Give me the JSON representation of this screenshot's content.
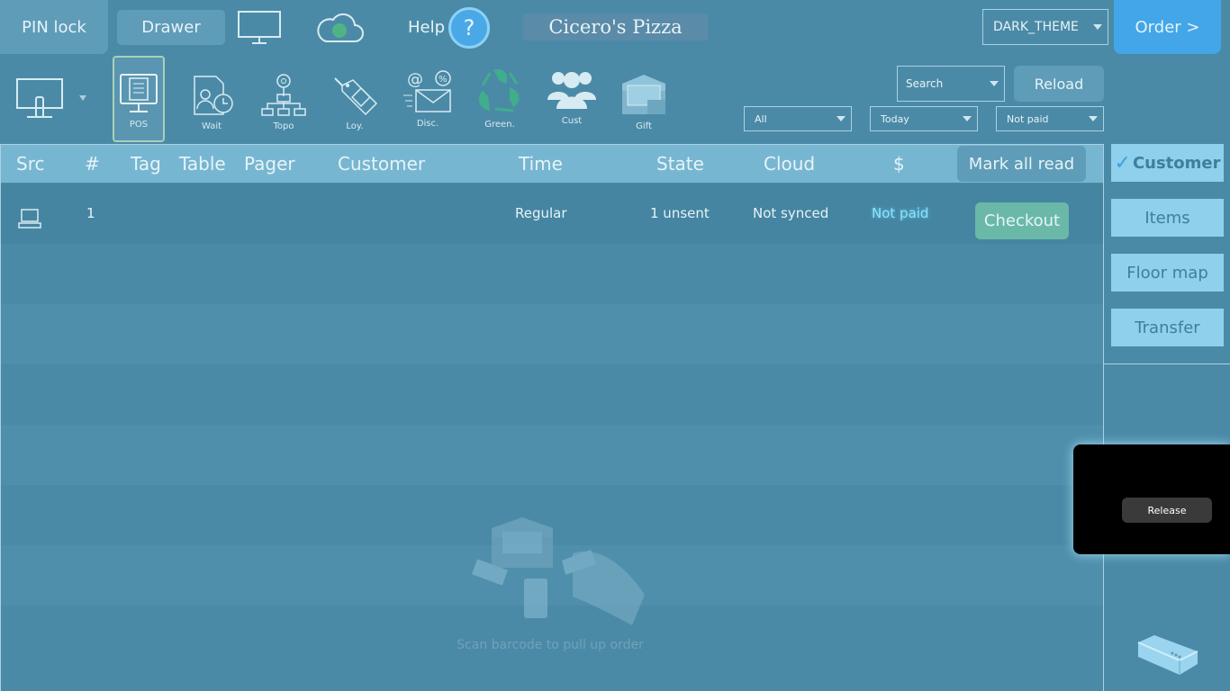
{
  "header": {
    "pin_lock": "PIN lock",
    "drawer": "Drawer",
    "help_label": "Help",
    "help_symbol": "?",
    "brand": "Cicero's Pizza",
    "theme": "DARK_THEME",
    "order": "Order >"
  },
  "toolbar": {
    "items": [
      {
        "label": "POS",
        "icon": "pos-icon"
      },
      {
        "label": "Wait",
        "icon": "wait-icon"
      },
      {
        "label": "Topo",
        "icon": "topology-icon"
      },
      {
        "label": "Loy.",
        "icon": "loyalty-icon"
      },
      {
        "label": "Disc.",
        "icon": "discount-icon"
      },
      {
        "label": "Green.",
        "icon": "green-icon"
      },
      {
        "label": "Cust",
        "icon": "customers-icon"
      },
      {
        "label": "Gift",
        "icon": "gift-card-icon"
      }
    ]
  },
  "filters": {
    "search_placeholder": "Search",
    "reload": "Reload",
    "type": "All",
    "date": "Today",
    "payment": "Not paid"
  },
  "table": {
    "columns": [
      "Src",
      "#",
      "Tag",
      "Table",
      "Pager",
      "Customer",
      "Time",
      "State",
      "Cloud",
      "$"
    ],
    "mark_all_read": "Mark all read",
    "rows": [
      {
        "src_icon": "laptop-icon",
        "number": "1",
        "tag": "",
        "table": "",
        "pager": "",
        "customer": "",
        "time": "Regular",
        "state": "1 unsent",
        "cloud": "Not synced",
        "paid": "Not paid",
        "action": "Checkout"
      }
    ],
    "empty_hint": "Scan barcode to pull up order"
  },
  "side": {
    "customer": "Customer",
    "items": "Items",
    "floor_map": "Floor map",
    "transfer": "Transfer"
  },
  "popup": {
    "release": "Release"
  }
}
